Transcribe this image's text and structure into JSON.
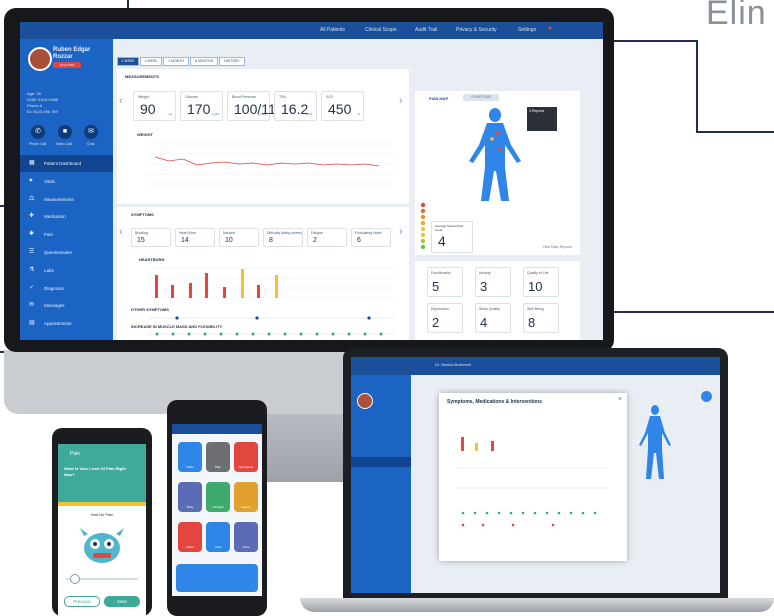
{
  "heading_fragment": "Elin",
  "colors": {
    "brand": "#1c4f99",
    "sidebar": "#1b64c3",
    "accent": "#2f86e8",
    "alert": "#e2463f"
  },
  "topbar": {
    "items": [
      "All Patients",
      "Clinical Scope",
      "Audit Trail",
      "Privacy & Security",
      "Settings"
    ]
  },
  "patient": {
    "name": "Ruben Edgar Rozzar",
    "badge": "HIGH RISK",
    "age": "Age: 35",
    "dob": "DOB: 01/01/1988",
    "phone": "Phone #",
    "id": "ID: 5123 456 789",
    "actions": [
      "Phone Call",
      "Video Call",
      "Chat"
    ]
  },
  "nav": [
    {
      "label": "Patient Dashboard",
      "icon": "dashboard-icon",
      "glyph": "▦"
    },
    {
      "label": "Vitals",
      "icon": "heart-icon",
      "glyph": "♥"
    },
    {
      "label": "Measurements",
      "icon": "scale-icon",
      "glyph": "⚖"
    },
    {
      "label": "Medication",
      "icon": "pill-icon",
      "glyph": "✚"
    },
    {
      "label": "Pain",
      "icon": "pain-icon",
      "glyph": "✱"
    },
    {
      "label": "Questionnaire",
      "icon": "clipboard-icon",
      "glyph": "☰"
    },
    {
      "label": "Labs",
      "icon": "flask-icon",
      "glyph": "⚗"
    },
    {
      "label": "Diagnosis",
      "icon": "stethoscope-icon",
      "glyph": "✓"
    },
    {
      "label": "Messages",
      "icon": "mail-icon",
      "glyph": "✉"
    },
    {
      "label": "Appointments",
      "icon": "calendar-icon",
      "glyph": "▤"
    }
  ],
  "range_tabs": [
    "1 WEEK",
    "1 WEEK",
    "1 MONTH",
    "6 MONTHS",
    "HISTORY"
  ],
  "measurements": {
    "title": "MEASUREMENTS",
    "items": [
      {
        "label": "Weight",
        "value": "90",
        "unit": "kg"
      },
      {
        "label": "Glucose",
        "value": "170",
        "unit": "mg/dl"
      },
      {
        "label": "Blood Pressure",
        "value": "100/110",
        "unit": "mmHg"
      },
      {
        "label": "TSH",
        "value": "16.2",
        "unit": "mIU/L"
      },
      {
        "label": "SO2",
        "value": "450",
        "unit": "%"
      }
    ],
    "chart_label": "WEIGHT"
  },
  "symptoms": {
    "title": "SYMPTOMS",
    "items": [
      {
        "label": "Bloating",
        "value": "15"
      },
      {
        "label": "Heart Burn",
        "value": "14"
      },
      {
        "label": "Nausea",
        "value": "10"
      },
      {
        "label": "Difficulty falling asleep",
        "value": "8"
      },
      {
        "label": "Fatigue",
        "value": "2"
      },
      {
        "label": "Fluctuating Heart",
        "value": "6"
      }
    ],
    "chart_label": "HEARTBURN",
    "row_labels": [
      "OTHER SYMPTOMS",
      "INCREASE IN MUSCLE MASS AND FLEXIBILITY"
    ]
  },
  "body_map": {
    "tabs": [
      "PAIN MAP",
      "SYMPTOMS"
    ],
    "tooltip": "3 Reports",
    "avg_label": "Average Scored Pain Level",
    "avg_value": "4",
    "link": "View Daily Reports"
  },
  "quality": {
    "items": [
      {
        "label": "Functionality",
        "value": "5"
      },
      {
        "label": "Anxiety",
        "value": "3"
      },
      {
        "label": "Quality of Life",
        "value": "10"
      },
      {
        "label": "Depression",
        "value": "2"
      },
      {
        "label": "Sleep Quality",
        "value": "4"
      },
      {
        "label": "Well Being",
        "value": "8"
      }
    ]
  },
  "phone_pain": {
    "title": "Pain",
    "question": "What Is Your Level Of Pain Right Now?",
    "caption": "Had No Pain",
    "prev": "Previous",
    "next": "Next"
  },
  "phone_home": {
    "tiles": [
      {
        "label": "Vitals",
        "color": "#2f86e8"
      },
      {
        "label": "Pain",
        "color": "#6d6f73"
      },
      {
        "label": "Symptoms",
        "color": "#e2463f"
      },
      {
        "label": "Body",
        "color": "#5b6bb5"
      },
      {
        "label": "Lifestyle",
        "color": "#3faa6d"
      },
      {
        "label": "Report",
        "color": "#e2a02f"
      },
      {
        "label": "Meds",
        "color": "#e2463f"
      },
      {
        "label": "Chat",
        "color": "#2f86e8"
      },
      {
        "label": "Docs",
        "color": "#5b6bb5"
      }
    ]
  },
  "laptop": {
    "modal_title": "Symptoms, Medications & Interventions",
    "doctor": "Dr. Marina Boltenmil"
  }
}
